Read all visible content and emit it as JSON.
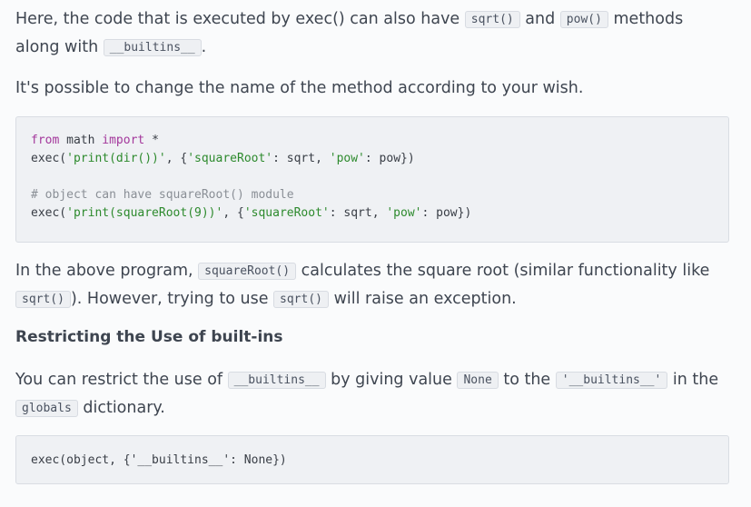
{
  "para1": {
    "t1": "Here, the code that is executed by exec() can also have ",
    "c1": "sqrt()",
    "t2": " and ",
    "c2": "pow()",
    "t3": " methods along with ",
    "c3": "__builtins__",
    "t4": "."
  },
  "para2": {
    "text": "It's possible to change the name of the method according to your wish."
  },
  "code1": {
    "l1_kw1": "from",
    "l1_mid": " math ",
    "l1_kw2": "import",
    "l1_end": " *",
    "l2_a": "exec(",
    "l2_s1": "'print(dir())'",
    "l2_b": ", {",
    "l2_s2": "'squareRoot'",
    "l2_c": ": sqrt, ",
    "l2_s3": "'pow'",
    "l2_d": ": pow})",
    "l4_comment": "# object can have squareRoot() module",
    "l5_a": "exec(",
    "l5_s1": "'print(squareRoot(9))'",
    "l5_b": ", {",
    "l5_s2": "'squareRoot'",
    "l5_c": ": sqrt, ",
    "l5_s3": "'pow'",
    "l5_d": ": pow})"
  },
  "para3": {
    "t1": "In the above program, ",
    "c1": "squareRoot()",
    "t2": " calculates the square root (similar functionality like ",
    "c2": "sqrt()",
    "t3": "). However, trying to use ",
    "c3": "sqrt()",
    "t4": " will raise an exception."
  },
  "heading": {
    "text": "Restricting the Use of built-ins"
  },
  "para4": {
    "t1": "You can restrict the use of ",
    "c1": "__builtins__",
    "t2": " by giving value ",
    "c2": "None",
    "t3": " to the ",
    "c3": "'__builtins__'",
    "t4": " in the ",
    "c4": "globals",
    "t5": " dictionary."
  },
  "code2": {
    "l1": "exec(object, {'__builtins__': None})"
  }
}
